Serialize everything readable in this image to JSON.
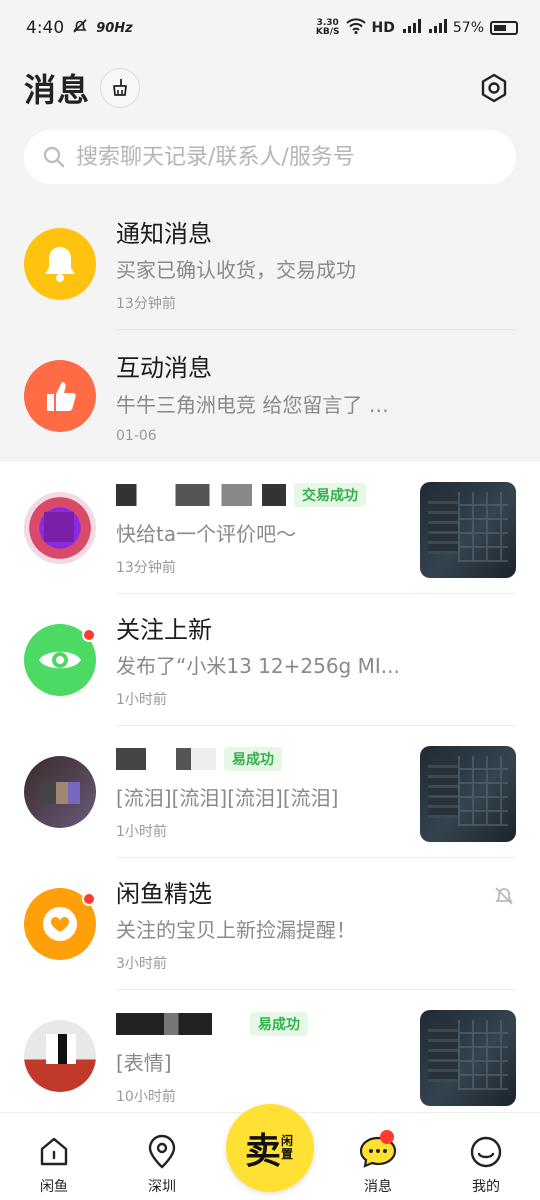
{
  "status": {
    "time": "4:40",
    "refresh": "90Hz",
    "speed_value": "3.30",
    "speed_unit": "KB/S",
    "network": "HD",
    "battery": "57%"
  },
  "header": {
    "title": "消息"
  },
  "search": {
    "placeholder": "搜索聊天记录/联系人/服务号"
  },
  "messages": [
    {
      "name": "通知消息",
      "preview": "买家已确认收货，交易成功",
      "time": "13分钟前",
      "avatar_color": "#ffc20e",
      "icon": "bell-icon"
    },
    {
      "name": "互动消息",
      "preview": "牛牛三角洲电竞 给您留言了 …",
      "time": "01-06",
      "avatar_color": "#ff6b45",
      "icon": "thumbs-up-icon"
    },
    {
      "name": "",
      "tag": "交易成功",
      "preview": "快给ta一个评价吧～",
      "time": "13分钟前"
    },
    {
      "name": "关注上新",
      "preview": "发布了“小米13  12+256g   MI...",
      "time": "1小时前",
      "avatar_color": "#4cd964",
      "icon": "eye-icon"
    },
    {
      "name": "",
      "tag": "易成功",
      "preview": "[流泪][流泪][流泪][流泪]",
      "time": "1小时前"
    },
    {
      "name": "闲鱼精选",
      "preview": "关注的宝贝上新捡漏提醒！",
      "time": "3小时前",
      "avatar_color": "#ff9f0a",
      "icon": "heart-icon"
    },
    {
      "name": "",
      "tag": "易成功",
      "preview": "[表情]",
      "time": "10小时前"
    }
  ],
  "tabs": [
    {
      "label": "闲鱼",
      "icon": "home-icon"
    },
    {
      "label": "深圳",
      "icon": "location-icon"
    },
    {
      "label": "消息",
      "icon": "chat-icon"
    },
    {
      "label": "我的",
      "icon": "profile-icon"
    }
  ],
  "sell": {
    "big": "卖",
    "small": "闲置"
  }
}
